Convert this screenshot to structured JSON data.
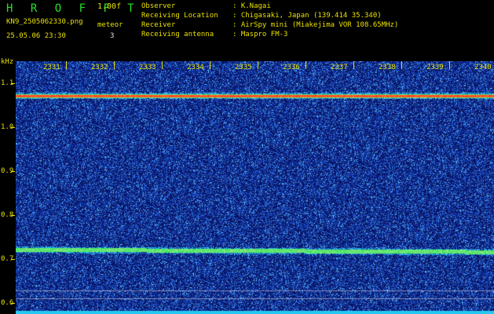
{
  "header": {
    "app_title": "H R O F F T",
    "version": "1.00f",
    "filename": "KN9_2505062330.png",
    "datetime": "25.05.06 23:30",
    "detection_label": "meteor",
    "detection_count": "3",
    "meta": [
      {
        "key": "Observer",
        "value": "K.Nagai"
      },
      {
        "key": "Receiving Location",
        "value": "Chigasaki, Japan (139.414 35.340)"
      },
      {
        "key": "Receiver",
        "value": "AirSpy mini (Miakejima VOR 108.65MHz)"
      },
      {
        "key": "Receiving antenna",
        "value": "Maspro FM-3"
      }
    ]
  },
  "spectrogram": {
    "y_unit": "kHz",
    "y_ticks": [
      "1.1",
      "1.0",
      "0.9",
      "0.8",
      "0.7",
      "0.6"
    ],
    "y_range": [
      0.575,
      1.15
    ],
    "x_ticks": [
      "2331",
      "2332",
      "2333",
      "2334",
      "2335",
      "2336",
      "2337",
      "2338",
      "2339",
      "2340"
    ],
    "signals": [
      {
        "name": "carrier",
        "freq_khz": 1.072
      },
      {
        "name": "carrier",
        "freq_khz": 0.722
      }
    ],
    "colors": {
      "background": "#0a1a6e",
      "noise": "#2a5ac8",
      "hot": "#ff2020",
      "warm": "#30e040",
      "floor": "#28c8f0",
      "text_yellow": "#e8e000",
      "text_green": "#27e027"
    }
  }
}
